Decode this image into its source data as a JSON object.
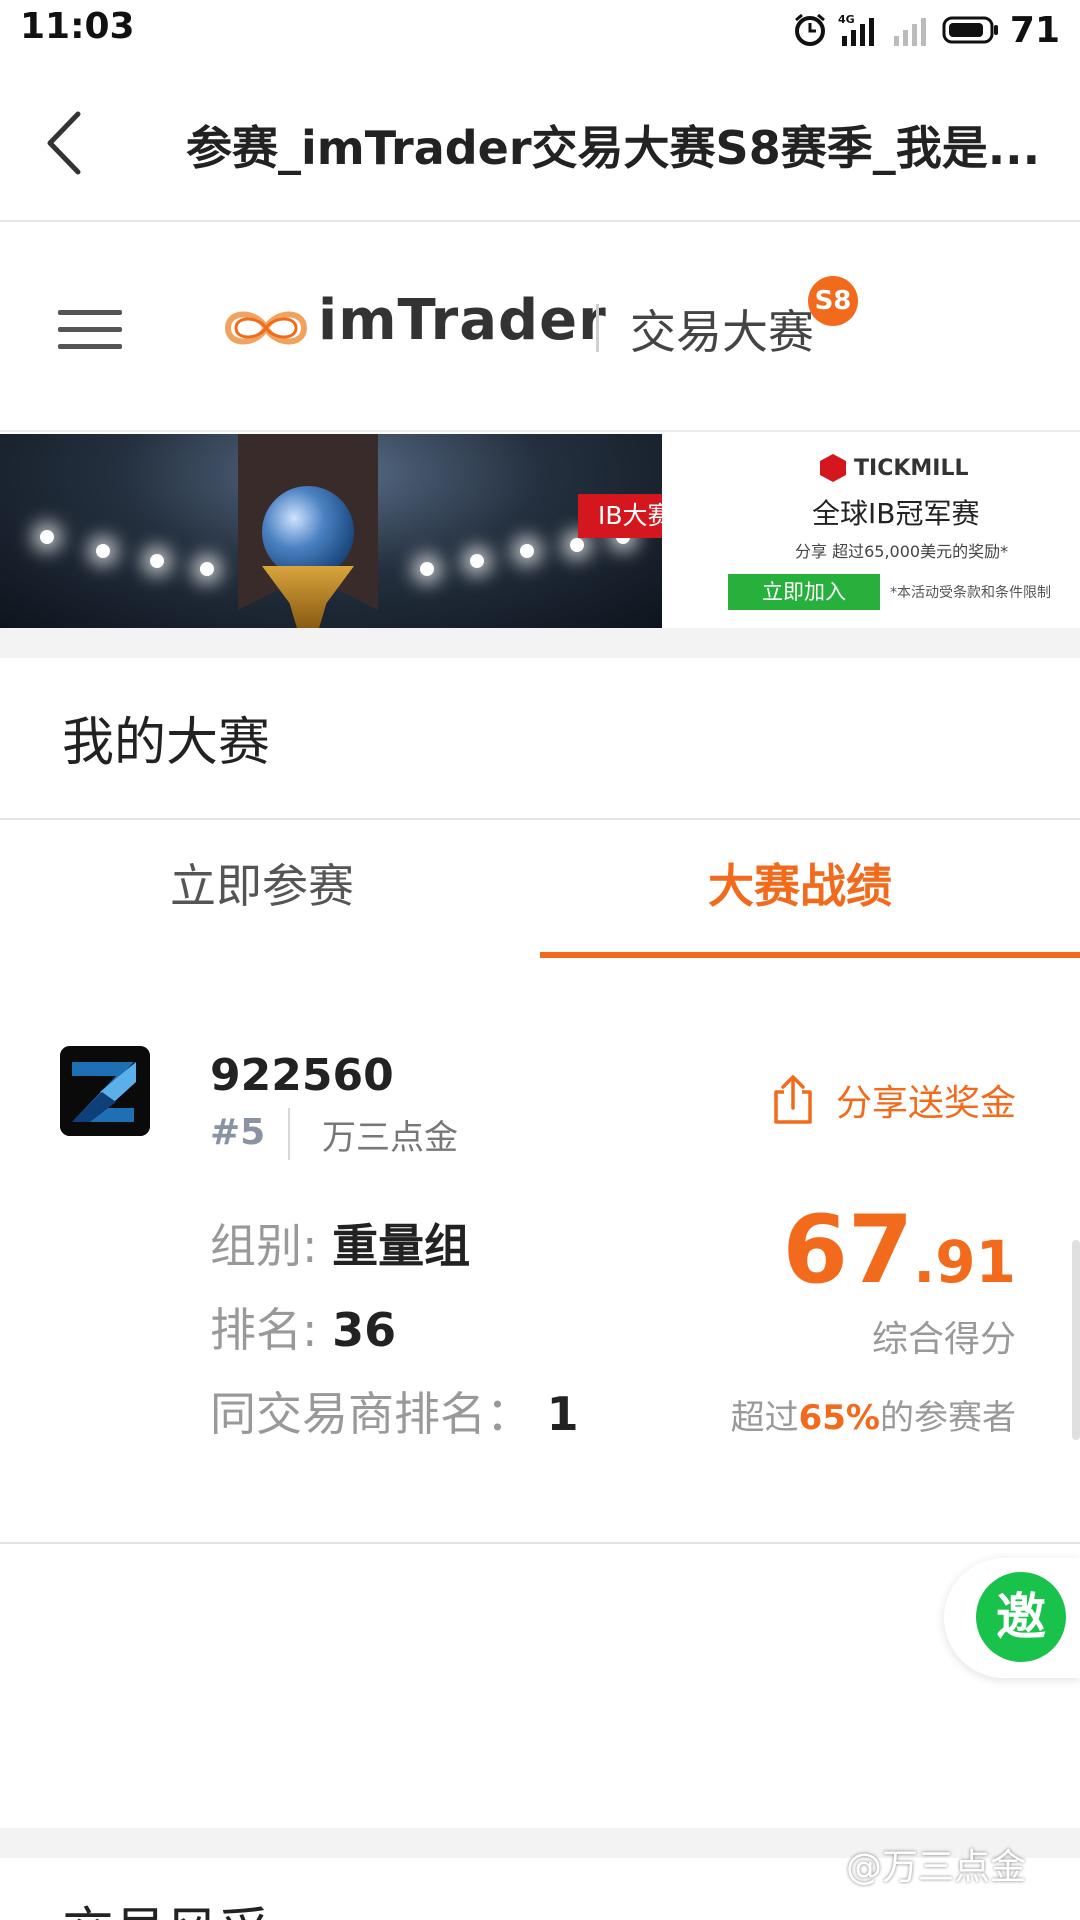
{
  "status_bar": {
    "time": "11:03",
    "network": "4G",
    "battery": "71",
    "icons": [
      "alarm-icon",
      "signal-icon",
      "signal-icon-empty",
      "battery-icon"
    ]
  },
  "title_bar": {
    "back_icon": "chevron-left-icon",
    "title": "参赛_imTrader交易大赛S8赛季_我是..."
  },
  "brand": {
    "menu_icon": "hamburger-menu-icon",
    "name": "imTrader",
    "subtitle": "交易大赛",
    "badge": "S8",
    "color": "#f26b1d"
  },
  "banner": {
    "tag": "IB大赛",
    "sponsor": "TICKMILL",
    "headline": "全球IB冠军赛",
    "text": "分享 超过65,000美元的奖励*",
    "button": "立即加入",
    "note": "*本活动受条款和条件限制"
  },
  "section": {
    "title": "我的大赛"
  },
  "tabs": [
    {
      "label": "立即参赛",
      "active": false
    },
    {
      "label": "大赛战绩",
      "active": true
    }
  ],
  "account": {
    "id": "922560",
    "rank_tag": "#5",
    "name": "万三点金",
    "share_label": "分享送奖金",
    "group_label": "组别:",
    "group_value": "重量组",
    "rank_label": "排名:",
    "rank_value": "36",
    "broker_rank_label": "同交易商排名：",
    "broker_rank_value": "1",
    "score_int": "67",
    "score_dec": ".91",
    "score_label": "综合得分",
    "percentile_prefix": "超过",
    "percentile_value": "65%",
    "percentile_suffix": "的参赛者"
  },
  "invite": {
    "label": "邀"
  },
  "next_section": {
    "title": "交易风采"
  },
  "watermark": "@万三点金",
  "colors": {
    "accent": "#f26b1d",
    "invite": "#19c24a",
    "ad_button": "#27b03b",
    "ad_red": "#d4161e"
  }
}
